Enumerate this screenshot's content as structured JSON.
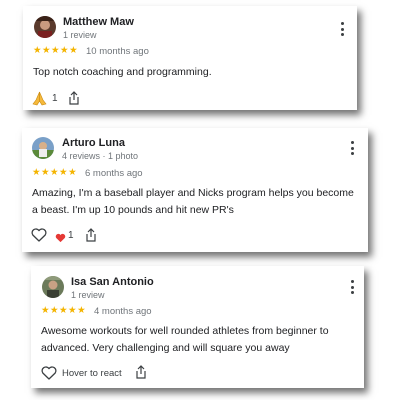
{
  "reviews": [
    {
      "author": "Matthew Maw",
      "meta": "1 review",
      "stars": "★★★★★",
      "time": "10 months ago",
      "text": "Top notch coaching and programming.",
      "reaction_count": "1",
      "reaction_icon": "folded-hands-icon"
    },
    {
      "author": "Arturo Luna",
      "meta": "4 reviews · 1 photo",
      "stars": "★★★★★",
      "time": "6 months ago",
      "text": "Amazing, I'm a baseball player and Nicks program helps you become a beast. I'm up 10 pounds and hit new PR's",
      "reaction_count": "1",
      "reaction_icon": "red-heart-icon"
    },
    {
      "author": "Isa San Antonio",
      "meta": "1 review",
      "stars": "★★★★★",
      "time": "4 months ago",
      "text": "Awesome workouts for well rounded athletes from beginner to advanced. Very challenging and will square you away",
      "hover_label": "Hover to react"
    }
  ],
  "colors": {
    "star": "#f4b400",
    "heart": "#e53935",
    "secondary_text": "#70757a"
  }
}
